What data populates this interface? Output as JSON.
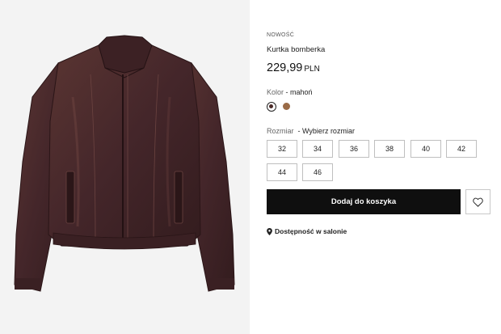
{
  "product": {
    "badge": "NOWOŚĆ",
    "name": "Kurtka bomberka",
    "price": "229,99",
    "currency": "PLN",
    "image_alt": "product-photo"
  },
  "color": {
    "label": "Kolor",
    "separator": " - ",
    "selected": "mahoń",
    "swatches": [
      {
        "name": "mahoń",
        "hex": "#4a2a28",
        "selected": true
      },
      {
        "name": "brązowy",
        "hex": "#9a6b47",
        "selected": false
      }
    ]
  },
  "size": {
    "label": "Rozmiar",
    "separator": "  - ",
    "prompt": "Wybierz rozmiar",
    "options": [
      "32",
      "34",
      "36",
      "38",
      "40",
      "42",
      "44",
      "46"
    ]
  },
  "actions": {
    "add_to_cart": "Dodaj do koszyka",
    "wishlist_icon": "heart-icon"
  },
  "store": {
    "label": "Dostępność w salonie",
    "icon": "location-pin-icon"
  },
  "colors": {
    "accent": "#0f0f0f",
    "jacket": "#4a2a28",
    "background": "#f3f3f3"
  }
}
